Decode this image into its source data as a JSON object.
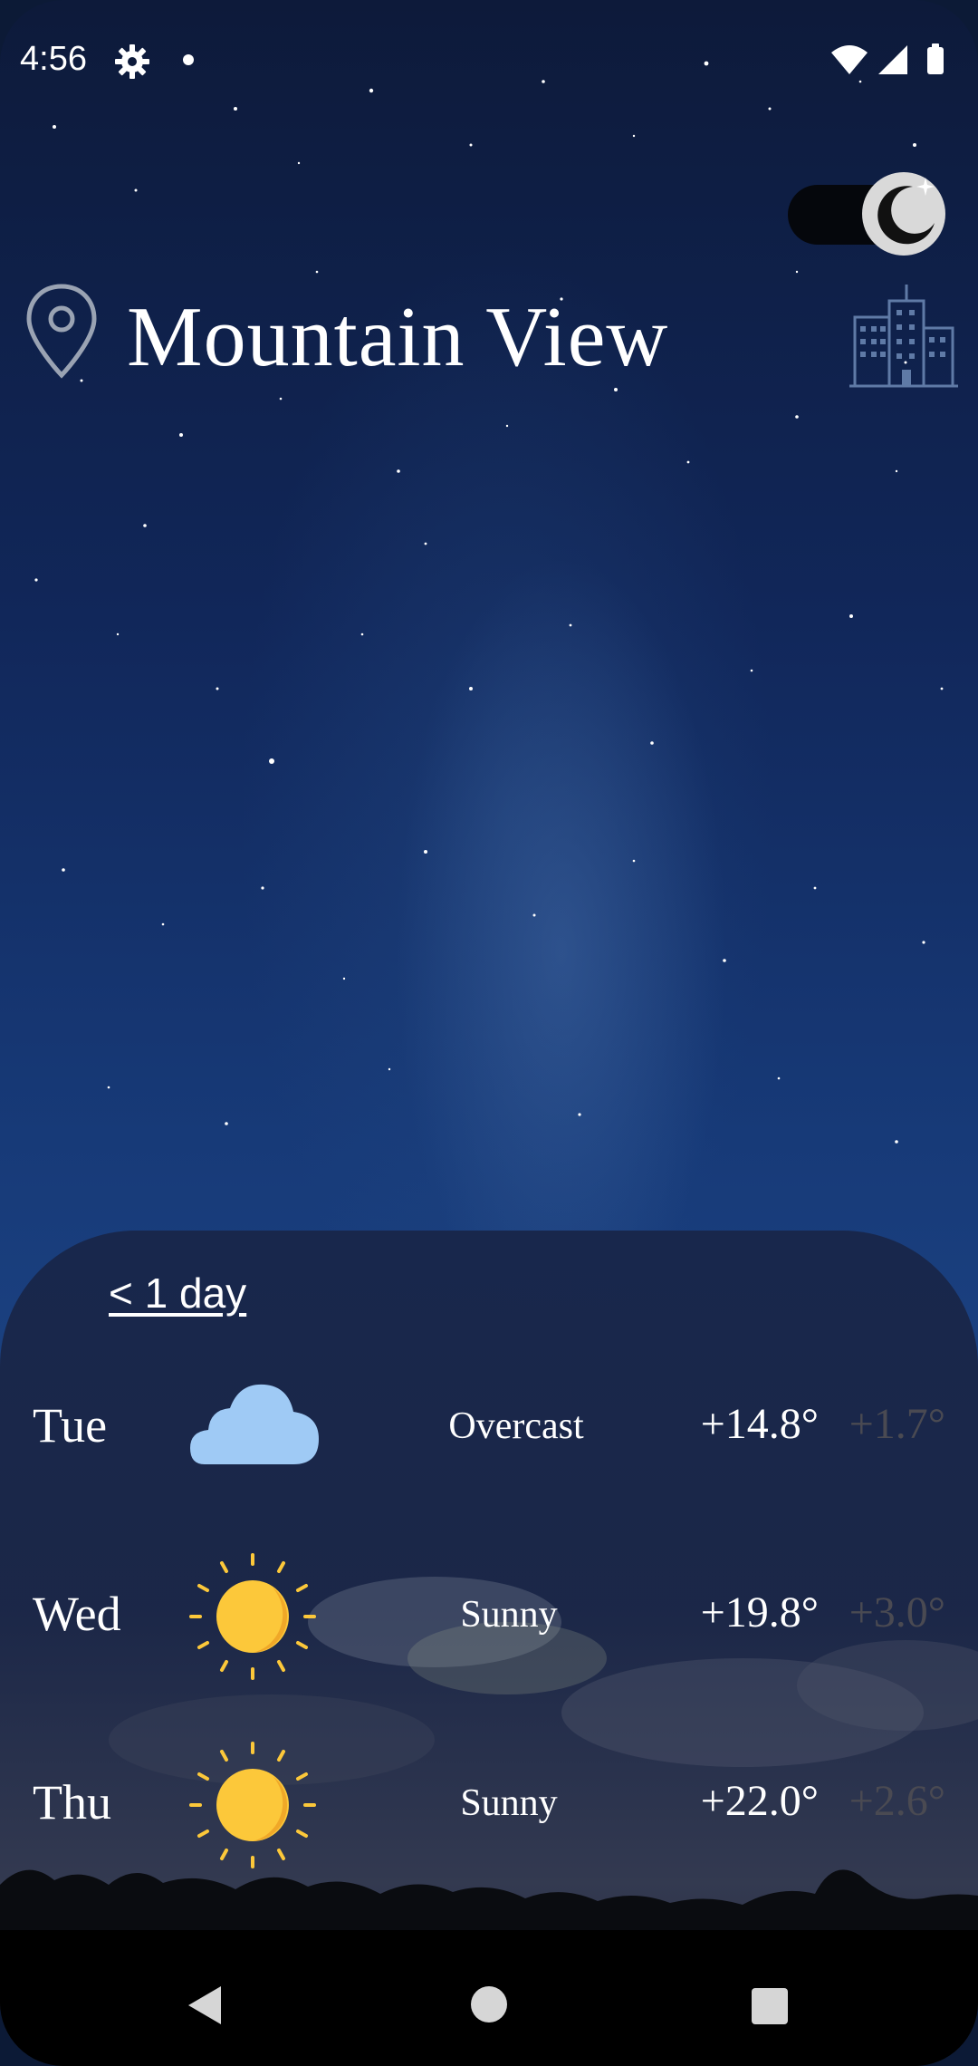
{
  "status_bar": {
    "time": "4:56",
    "icons": [
      "gear-icon",
      "notification-dot",
      "wifi-icon",
      "cell-signal-icon",
      "battery-icon"
    ]
  },
  "header": {
    "city": "Mountain View",
    "theme_toggle": {
      "state": "dark",
      "icon": "moon-icon"
    },
    "location_icon": "map-pin-icon",
    "city_icon": "buildings-icon"
  },
  "forecast": {
    "range_label": "< 1 day",
    "days": [
      {
        "day": "Tue",
        "icon": "cloud-icon",
        "condition": "Overcast",
        "max": "+14.8°",
        "min": "+1.7°"
      },
      {
        "day": "Wed",
        "icon": "sun-icon",
        "condition": "Sunny",
        "max": "+19.8°",
        "min": "+3.0°"
      },
      {
        "day": "Thu",
        "icon": "sun-icon",
        "condition": "Sunny",
        "max": "+22.0°",
        "min": "+2.6°"
      }
    ]
  },
  "colors": {
    "sky_top": "#0d1a3a",
    "sky_mid": "#173a78",
    "panel": "#1b2646",
    "text": "#ffffff",
    "min_temp": "#4a4a52",
    "sun": "#fcc83a",
    "cloud": "#9fcaf5"
  },
  "nav_bar": {
    "buttons": [
      "back-icon",
      "home-icon",
      "recents-icon"
    ]
  }
}
